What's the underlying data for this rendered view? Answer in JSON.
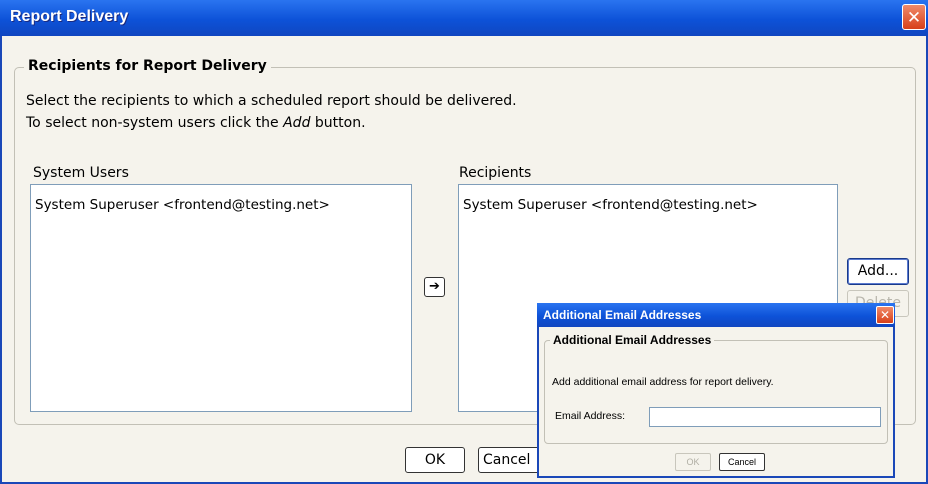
{
  "dialog": {
    "title": "Report Delivery",
    "close_icon": "close-icon",
    "group_title": "Recipients for Report Delivery",
    "description_line1": "Select the recipients to which a scheduled report should be delivered.",
    "description_line2_prefix": "To select non-system users click the ",
    "description_line2_emph": "Add",
    "description_line2_suffix": " button.",
    "system_users_label": "System Users",
    "recipients_label": "Recipients",
    "system_users": [
      "System Superuser <frontend@testing.net>"
    ],
    "recipients": [
      "System Superuser <frontend@testing.net>"
    ],
    "arrow_button": "➔",
    "add_label": "Add...",
    "delete_label": "Delete",
    "ok_label": "OK",
    "cancel_label": "Cancel"
  },
  "popup": {
    "title": "Additional Email Addresses",
    "group_title": "Additional Email Addresses",
    "description": "Add additional email address for report delivery.",
    "email_label": "Email Address:",
    "email_value": "",
    "ok_label": "OK",
    "cancel_label": "Cancel"
  },
  "colors": {
    "title_bar": "#0d52d8",
    "close": "#d8401a"
  }
}
